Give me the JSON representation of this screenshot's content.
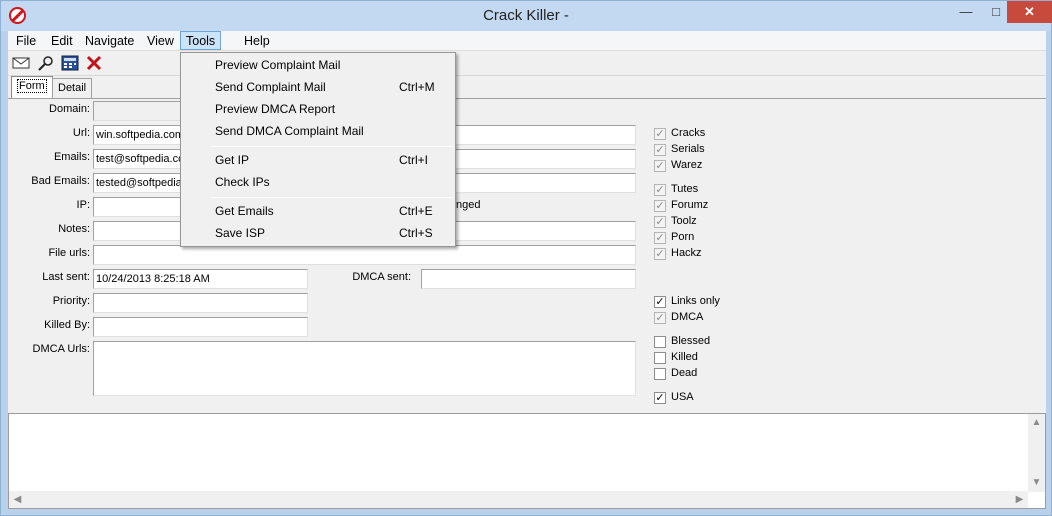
{
  "window": {
    "title": "Crack Killer -",
    "min_glyph": "—",
    "max_glyph": "□",
    "close_glyph": "✕"
  },
  "menubar": {
    "items": [
      "File",
      "Edit",
      "Navigate",
      "View",
      "Tools",
      "Help"
    ],
    "active": "Tools"
  },
  "toolbar": {
    "icons": [
      "envelope-icon",
      "search-person-icon",
      "calculator-icon",
      "delete-x-icon"
    ]
  },
  "tabs": [
    "Form",
    "Detail"
  ],
  "form": {
    "domain_label": "Domain:",
    "domain_value": "",
    "url_label": "Url:",
    "url_value": "win.softpedia.com",
    "emails_label": "Emails:",
    "emails_value": "test@softpedia.com",
    "bad_emails_label": "Bad Emails:",
    "bad_emails_value": "tested@softpedia.com",
    "ip_label": "IP:",
    "ip_value": "",
    "ip_changed_text": "nged",
    "notes_label": "Notes:",
    "notes_value": "",
    "file_urls_label": "File urls:",
    "file_urls_value": "",
    "last_sent_label": "Last sent:",
    "last_sent_value": "10/24/2013 8:25:18 AM",
    "dmca_sent_label": "DMCA sent:",
    "dmca_sent_value": "",
    "priority_label": "Priority:",
    "priority_value": "",
    "killed_by_label": "Killed By:",
    "killed_by_value": "",
    "dmca_urls_label": "DMCA Urls:",
    "dmca_urls_value": ""
  },
  "checkboxes": [
    {
      "label": "Cracks",
      "checked": true,
      "disabled": true
    },
    {
      "label": "Serials",
      "checked": true,
      "disabled": true
    },
    {
      "label": "Warez",
      "checked": true,
      "disabled": true
    },
    {
      "label": "Tutes",
      "checked": true,
      "disabled": true
    },
    {
      "label": "Forumz",
      "checked": true,
      "disabled": true
    },
    {
      "label": "Toolz",
      "checked": true,
      "disabled": true
    },
    {
      "label": "Porn",
      "checked": true,
      "disabled": true
    },
    {
      "label": "Hackz",
      "checked": true,
      "disabled": true
    },
    {
      "label": "Links only",
      "checked": true,
      "disabled": false
    },
    {
      "label": "DMCA",
      "checked": true,
      "disabled": true
    },
    {
      "label": "Blessed",
      "checked": false,
      "disabled": false
    },
    {
      "label": "Killed",
      "checked": false,
      "disabled": false
    },
    {
      "label": "Dead",
      "checked": false,
      "disabled": false
    },
    {
      "label": "USA",
      "checked": true,
      "disabled": false
    }
  ],
  "tools_menu": {
    "preview_complaint": {
      "label": "Preview Complaint Mail",
      "shortcut": ""
    },
    "send_complaint": {
      "label": "Send Complaint Mail",
      "shortcut": "Ctrl+M"
    },
    "preview_dmca": {
      "label": "Preview DMCA Report",
      "shortcut": ""
    },
    "send_dmca": {
      "label": "Send DMCA Complaint Mail",
      "shortcut": ""
    },
    "get_ip": {
      "label": "Get IP",
      "shortcut": "Ctrl+I"
    },
    "check_ips": {
      "label": "Check IPs",
      "shortcut": ""
    },
    "get_emails": {
      "label": "Get Emails",
      "shortcut": "Ctrl+E"
    },
    "save_isp": {
      "label": "Save ISP",
      "shortcut": "Ctrl+S"
    }
  },
  "colors": {
    "close_button": "#c74a3d",
    "menu_highlight": "#cce4f7",
    "titlebar": "#c3d9f1"
  }
}
